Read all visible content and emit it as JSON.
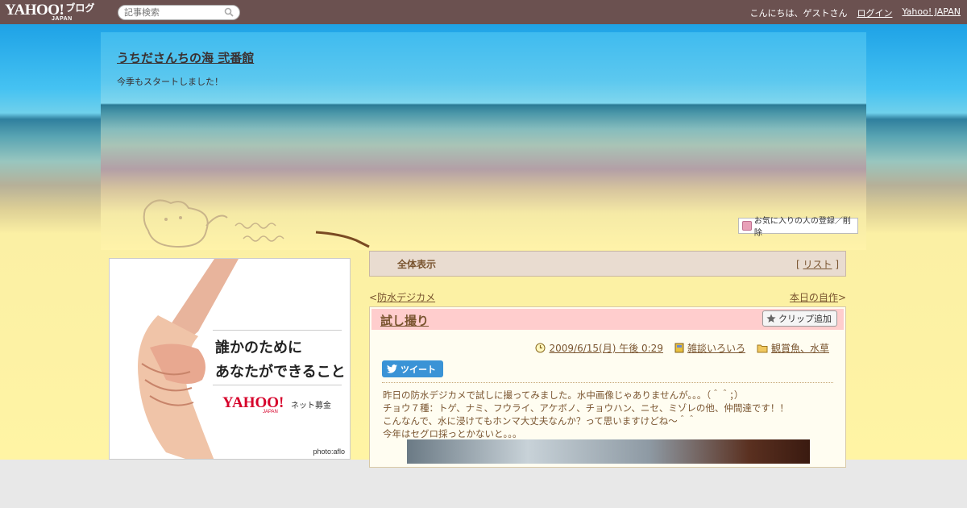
{
  "topbar": {
    "logo_main": "YAHOO!",
    "logo_sub": "JAPAN",
    "logo_service": "ブログ",
    "search_placeholder": "記事検索",
    "greeting": "こんにちは、ゲストさん",
    "login_link": "ログイン",
    "yahoo_link": "Yahoo! JAPAN"
  },
  "header": {
    "blog_title": "うちださんちの海 弐番館",
    "blog_desc": "今季もスタートしました！",
    "fav_button": "お気に入りの人の登録／削除"
  },
  "ad": {
    "line1": "誰かのために",
    "line2": "あなたができること",
    "logo": "YAHOO!",
    "logo_sub": "JAPAN",
    "service": "ネット募金",
    "credit": "photo:aflo"
  },
  "category_bar": {
    "label": "全体表示",
    "list_link": "リスト",
    "bracket_open": "[",
    "bracket_close": "]"
  },
  "nav": {
    "prev_arrow": "<",
    "prev_label": "防水デジカメ",
    "next_label": "本日の自作",
    "next_arrow": ">"
  },
  "post": {
    "title": "試し撮り",
    "clip_button": "クリップ追加",
    "date": "2009/6/15(月) 午後 0:29",
    "category1": "雑談いろいろ",
    "category2": "観賞魚、水草",
    "tweet_button": "ツイート",
    "lines": [
      "昨日の防水デジカメで試しに撮ってみました。水中画像じゃありませんが。。。（＾＾；）",
      "チョウ７種：トゲ、ナミ、フウライ、アケボノ、チョウハン、ニセ、ミゾレの他、仲間達です！！",
      "こんなんで、水に浸けてもホンマ大丈夫なんか？って思いますけどね～＾＾",
      "今年はセグロ採っとかないと。。。"
    ]
  },
  "colors": {
    "topbar": "#6b5150",
    "post_header": "#ffcdcd",
    "text": "#7a5530",
    "tweet": "#3a93d6"
  }
}
